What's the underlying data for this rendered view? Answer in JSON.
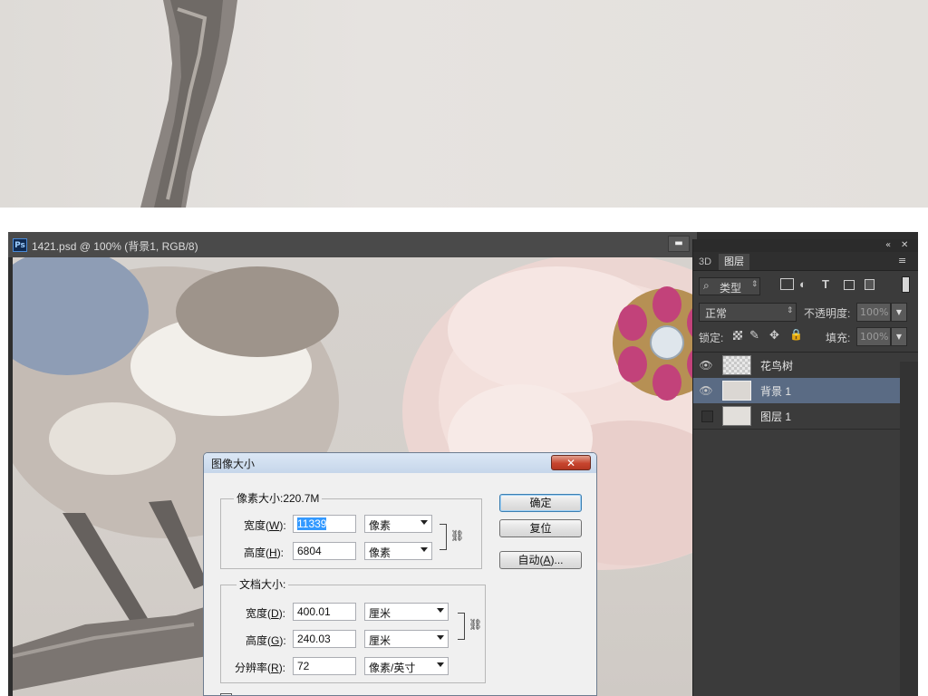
{
  "document": {
    "app_icon": "Ps",
    "title": "1421.psd @ 100% (背景1, RGB/8)"
  },
  "panels": {
    "topbar_icons": [
      "collapse-arrows-icon",
      "close-icon",
      "panel-menu-icon"
    ],
    "tabs": [
      {
        "label": "3D"
      },
      {
        "label": "图层"
      }
    ],
    "filter": {
      "kind_label": "类型",
      "icons": [
        "image-filter-icon",
        "adjustment-filter-icon",
        "text-filter-icon",
        "shape-filter-icon",
        "smart-object-filter-icon"
      ]
    },
    "blend_mode": "正常",
    "opacity_label": "不透明度:",
    "opacity_value": "100%",
    "lock_label": "锁定:",
    "fill_label": "填充:",
    "fill_value": "100%",
    "layers": [
      {
        "name": "花鸟树",
        "visible": true,
        "selected": false
      },
      {
        "name": "背景 1",
        "visible": true,
        "selected": true
      },
      {
        "name": "图层 1",
        "visible": false,
        "selected": false
      }
    ]
  },
  "dialog": {
    "title": "图像大小",
    "pixel_dimensions_label": "像素大小:220.7M",
    "width_label": "宽度",
    "width_key": "W",
    "width_value": "11339",
    "width_unit": "像素",
    "height_label": "高度",
    "height_key": "H",
    "height_value": "6804",
    "height_unit": "像素",
    "document_size_label": "文档大小:",
    "doc_width_label": "宽度",
    "doc_width_key": "D",
    "doc_width_value": "400.01",
    "doc_width_unit": "厘米",
    "doc_height_label": "高度",
    "doc_height_key": "G",
    "doc_height_value": "240.03",
    "doc_height_unit": "厘米",
    "resolution_label": "分辨率",
    "resolution_key": "R",
    "resolution_value": "72",
    "resolution_unit": "像素/英寸",
    "ok_label": "确定",
    "reset_label": "复位",
    "auto_label": "自动",
    "auto_key": "A",
    "close_glyph": "✕"
  }
}
